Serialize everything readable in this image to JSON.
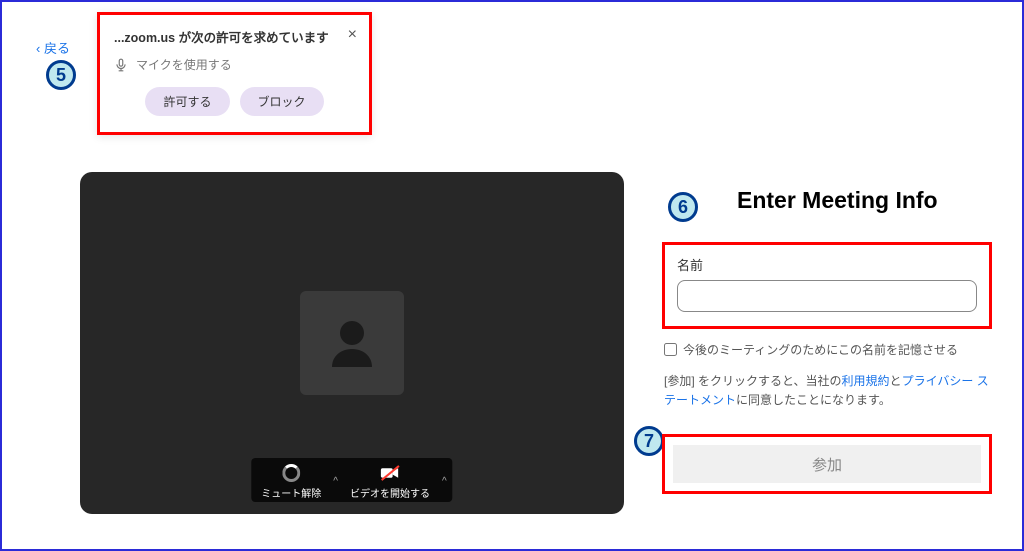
{
  "nav": {
    "back": "戻る"
  },
  "permission": {
    "title": "...zoom.us が次の許可を求めています",
    "mic_label": "マイクを使用する",
    "allow": "許可する",
    "block": "ブロック"
  },
  "steps": {
    "s5": "5",
    "s6": "6",
    "s7": "7"
  },
  "toolbar": {
    "unmute": "ミュート解除",
    "start_video": "ビデオを開始する"
  },
  "meeting": {
    "title": "Enter Meeting Info",
    "name_label": "名前",
    "remember": "今後のミーティングのためにこの名前を記憶させる",
    "terms_prefix": "[参加] をクリックすると、当社の",
    "terms_link": "利用規約",
    "terms_and": "と",
    "privacy_link": "プライバシー ステートメント",
    "terms_suffix": "に同意したことになります。",
    "join": "参加"
  }
}
